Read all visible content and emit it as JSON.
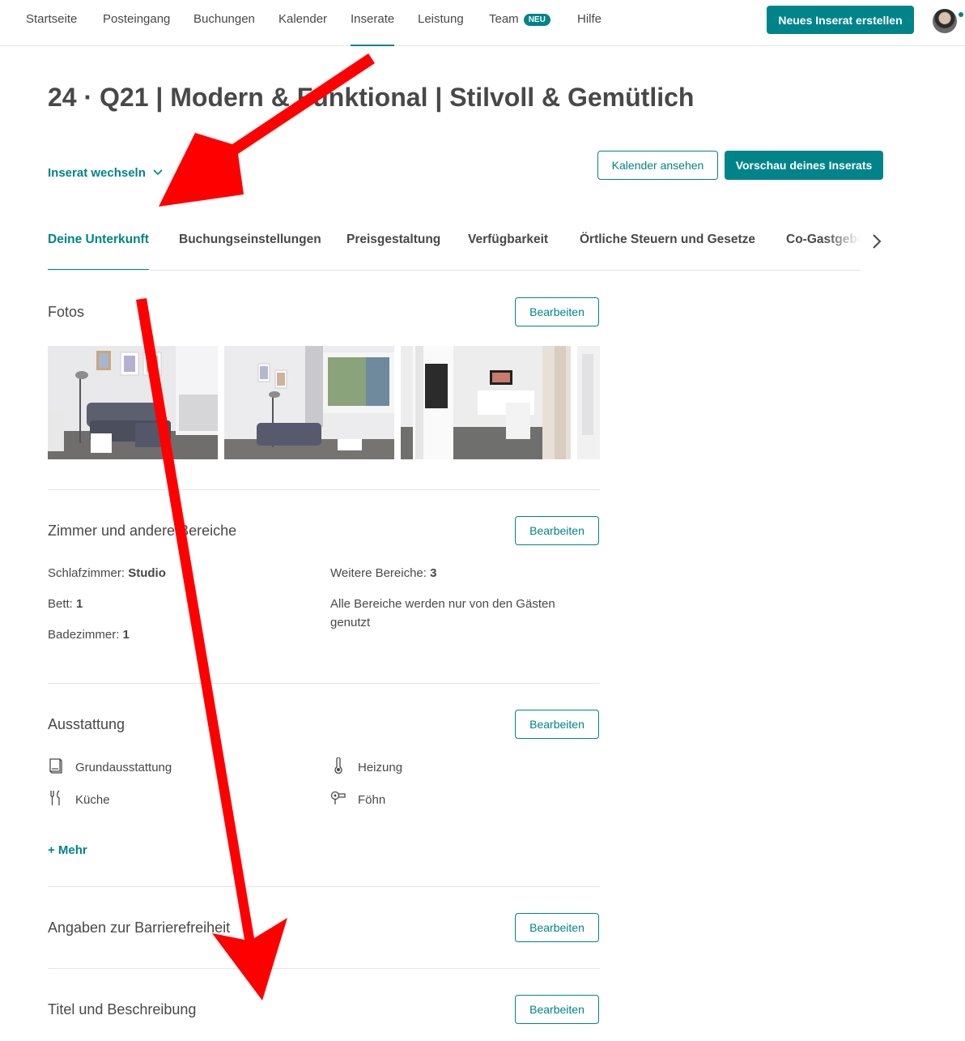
{
  "nav": {
    "items": [
      {
        "label": "Startseite"
      },
      {
        "label": "Posteingang"
      },
      {
        "label": "Buchungen"
      },
      {
        "label": "Kalender"
      },
      {
        "label": "Inserate"
      },
      {
        "label": "Leistung"
      },
      {
        "label": "Team"
      },
      {
        "label": "Hilfe"
      }
    ],
    "active": "Inserate",
    "team_badge": "NEU",
    "create_button": "Neues Inserat erstellen"
  },
  "listing": {
    "title": "24 · Q21 | Modern & Funktional | Stilvoll & Gemütlich",
    "switch_label": "Inserat wechseln",
    "calendar_button": "Kalender ansehen",
    "preview_button": "Vorschau deines Inserats"
  },
  "tabs": [
    {
      "label": "Deine Unterkunft"
    },
    {
      "label": "Buchungseinstellungen"
    },
    {
      "label": "Preisgestaltung"
    },
    {
      "label": "Verfügbarkeit"
    },
    {
      "label": "Örtliche Steuern und Gesetze"
    },
    {
      "label": "Co-Gastgeber"
    }
  ],
  "active_tab": "Deine Unterkunft",
  "sections": {
    "edit_label": "Bearbeiten",
    "photos": {
      "title": "Fotos"
    },
    "rooms": {
      "title": "Zimmer und andere Bereiche",
      "bedrooms_label": "Schlafzimmer:",
      "bedrooms_value": "Studio",
      "beds_label": "Bett:",
      "beds_value": "1",
      "bathrooms_label": "Badezimmer:",
      "bathrooms_value": "1",
      "other_areas_label": "Weitere Bereiche:",
      "other_areas_value": "3",
      "shared_note": "Alle Bereiche werden nur von den Gästen genutzt"
    },
    "amenities": {
      "title": "Ausstattung",
      "items": [
        {
          "label": "Grundausstattung",
          "icon": "essentials-icon"
        },
        {
          "label": "Heizung",
          "icon": "thermometer-icon"
        },
        {
          "label": "Küche",
          "icon": "cutlery-icon"
        },
        {
          "label": "Föhn",
          "icon": "hairdryer-icon"
        }
      ],
      "more_label": "+ Mehr"
    },
    "accessibility": {
      "title": "Angaben zur Barrierefreiheit"
    },
    "description": {
      "title": "Titel und Beschreibung"
    }
  },
  "colors": {
    "accent": "#008489",
    "text": "#484848",
    "annotation_arrow": "#ff0000"
  }
}
